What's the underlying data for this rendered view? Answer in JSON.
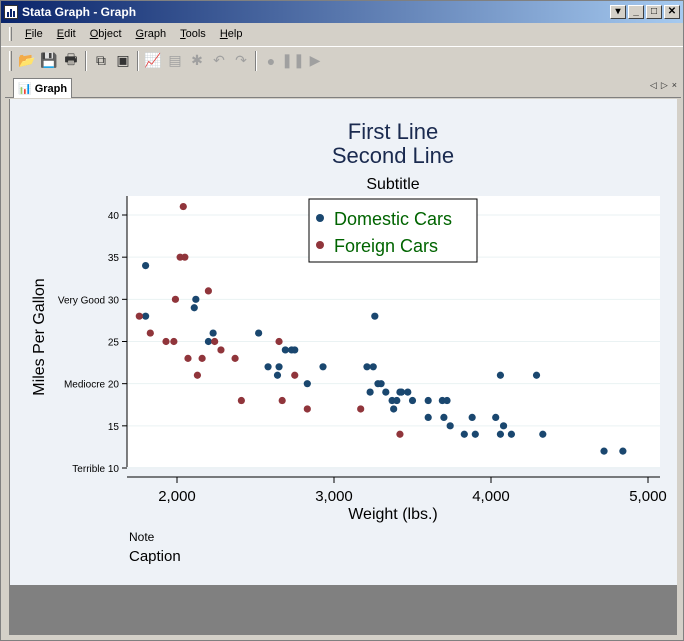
{
  "window": {
    "title": "Stata Graph - Graph",
    "buttons": [
      "restore",
      "minimize",
      "maximize",
      "close"
    ]
  },
  "menubar": {
    "items": [
      {
        "label": "File",
        "accel": "F"
      },
      {
        "label": "Edit",
        "accel": "E"
      },
      {
        "label": "Object",
        "accel": "O"
      },
      {
        "label": "Graph",
        "accel": "G"
      },
      {
        "label": "Tools",
        "accel": "T"
      },
      {
        "label": "Help",
        "accel": "H"
      }
    ]
  },
  "toolbar": {
    "buttons": [
      {
        "name": "open-graph-icon",
        "glyph": "📂",
        "enabled": true
      },
      {
        "name": "save-icon",
        "glyph": "💾",
        "enabled": true
      },
      {
        "name": "print-icon",
        "glyph": "🖶",
        "enabled": true
      },
      {
        "sep": true
      },
      {
        "name": "copy-icon",
        "glyph": "⧉",
        "enabled": true
      },
      {
        "name": "rename-icon",
        "glyph": "▣",
        "enabled": true
      },
      {
        "sep": true
      },
      {
        "name": "graph-editor-icon",
        "glyph": "📈",
        "enabled": true
      },
      {
        "name": "object-browser-icon",
        "glyph": "▤",
        "enabled": false
      },
      {
        "name": "pointer-icon",
        "glyph": "✱",
        "enabled": false
      },
      {
        "name": "undo-icon",
        "glyph": "↶",
        "enabled": false
      },
      {
        "name": "redo-icon",
        "glyph": "↷",
        "enabled": false
      },
      {
        "sep": true
      },
      {
        "name": "record-icon",
        "glyph": "●",
        "enabled": false
      },
      {
        "name": "pause-icon",
        "glyph": "❚❚",
        "enabled": false
      },
      {
        "name": "play-icon",
        "glyph": "▶",
        "enabled": false
      }
    ]
  },
  "tabs": [
    {
      "label": "Graph"
    }
  ],
  "tab_nav": {
    "prev": "◁",
    "next": "▷",
    "close": "×"
  },
  "chart_data": {
    "type": "scatter",
    "title": [
      "First Line",
      "Second Line"
    ],
    "subtitle": "Subtitle",
    "xlabel": "Weight (lbs.)",
    "ylabel": "Miles Per Gallon",
    "note": "Note",
    "caption": "Caption",
    "xlim": [
      1700,
      5050
    ],
    "ylim": [
      9,
      42
    ],
    "xticks": [
      {
        "value": 2000,
        "label": "2,000"
      },
      {
        "value": 3000,
        "label": "3,000"
      },
      {
        "value": 4000,
        "label": "4,000"
      },
      {
        "value": 5000,
        "label": "5,000"
      }
    ],
    "yticks": [
      {
        "value": 10,
        "label": "Terrible 10"
      },
      {
        "value": 15,
        "label": "15"
      },
      {
        "value": 20,
        "label": "Mediocre 20"
      },
      {
        "value": 25,
        "label": "25"
      },
      {
        "value": 30,
        "label": "Very Good 30"
      },
      {
        "value": 35,
        "label": "35"
      },
      {
        "value": 40,
        "label": "40"
      }
    ],
    "grid": "horizontal",
    "legend": {
      "position": "top-center",
      "text_color": "#006400"
    },
    "series": [
      {
        "name": "Domestic Cars",
        "color": "#1a476f",
        "points": [
          [
            1800,
            34
          ],
          [
            1800,
            28
          ],
          [
            2110,
            29
          ],
          [
            2120,
            30
          ],
          [
            2200,
            25
          ],
          [
            2230,
            26
          ],
          [
            2520,
            26
          ],
          [
            2580,
            22
          ],
          [
            2640,
            21
          ],
          [
            2650,
            22
          ],
          [
            2690,
            24
          ],
          [
            2730,
            24
          ],
          [
            2750,
            24
          ],
          [
            2830,
            20
          ],
          [
            2930,
            22
          ],
          [
            3210,
            22
          ],
          [
            3250,
            22
          ],
          [
            3230,
            19
          ],
          [
            3280,
            20
          ],
          [
            3300,
            20
          ],
          [
            3260,
            28
          ],
          [
            3330,
            19
          ],
          [
            3370,
            18
          ],
          [
            3380,
            17
          ],
          [
            3400,
            18
          ],
          [
            3420,
            19
          ],
          [
            3430,
            19
          ],
          [
            3470,
            19
          ],
          [
            3500,
            18
          ],
          [
            3600,
            18
          ],
          [
            3600,
            16
          ],
          [
            3690,
            18
          ],
          [
            3720,
            18
          ],
          [
            3700,
            16
          ],
          [
            3740,
            15
          ],
          [
            3830,
            14
          ],
          [
            3880,
            16
          ],
          [
            3900,
            14
          ],
          [
            4030,
            16
          ],
          [
            4060,
            14
          ],
          [
            4080,
            15
          ],
          [
            4130,
            14
          ],
          [
            4060,
            21
          ],
          [
            4290,
            21
          ],
          [
            4330,
            14
          ],
          [
            4720,
            12
          ],
          [
            4840,
            12
          ]
        ]
      },
      {
        "name": "Foreign Cars",
        "color": "#90353b",
        "points": [
          [
            1760,
            28
          ],
          [
            1830,
            26
          ],
          [
            1930,
            25
          ],
          [
            1980,
            25
          ],
          [
            1990,
            30
          ],
          [
            2020,
            35
          ],
          [
            2050,
            35
          ],
          [
            2040,
            41
          ],
          [
            2070,
            23
          ],
          [
            2130,
            21
          ],
          [
            2160,
            23
          ],
          [
            2200,
            31
          ],
          [
            2240,
            25
          ],
          [
            2280,
            24
          ],
          [
            2370,
            23
          ],
          [
            2410,
            18
          ],
          [
            2650,
            25
          ],
          [
            2670,
            18
          ],
          [
            2750,
            21
          ],
          [
            2830,
            17
          ],
          [
            3170,
            17
          ],
          [
            3420,
            14
          ]
        ]
      }
    ]
  }
}
